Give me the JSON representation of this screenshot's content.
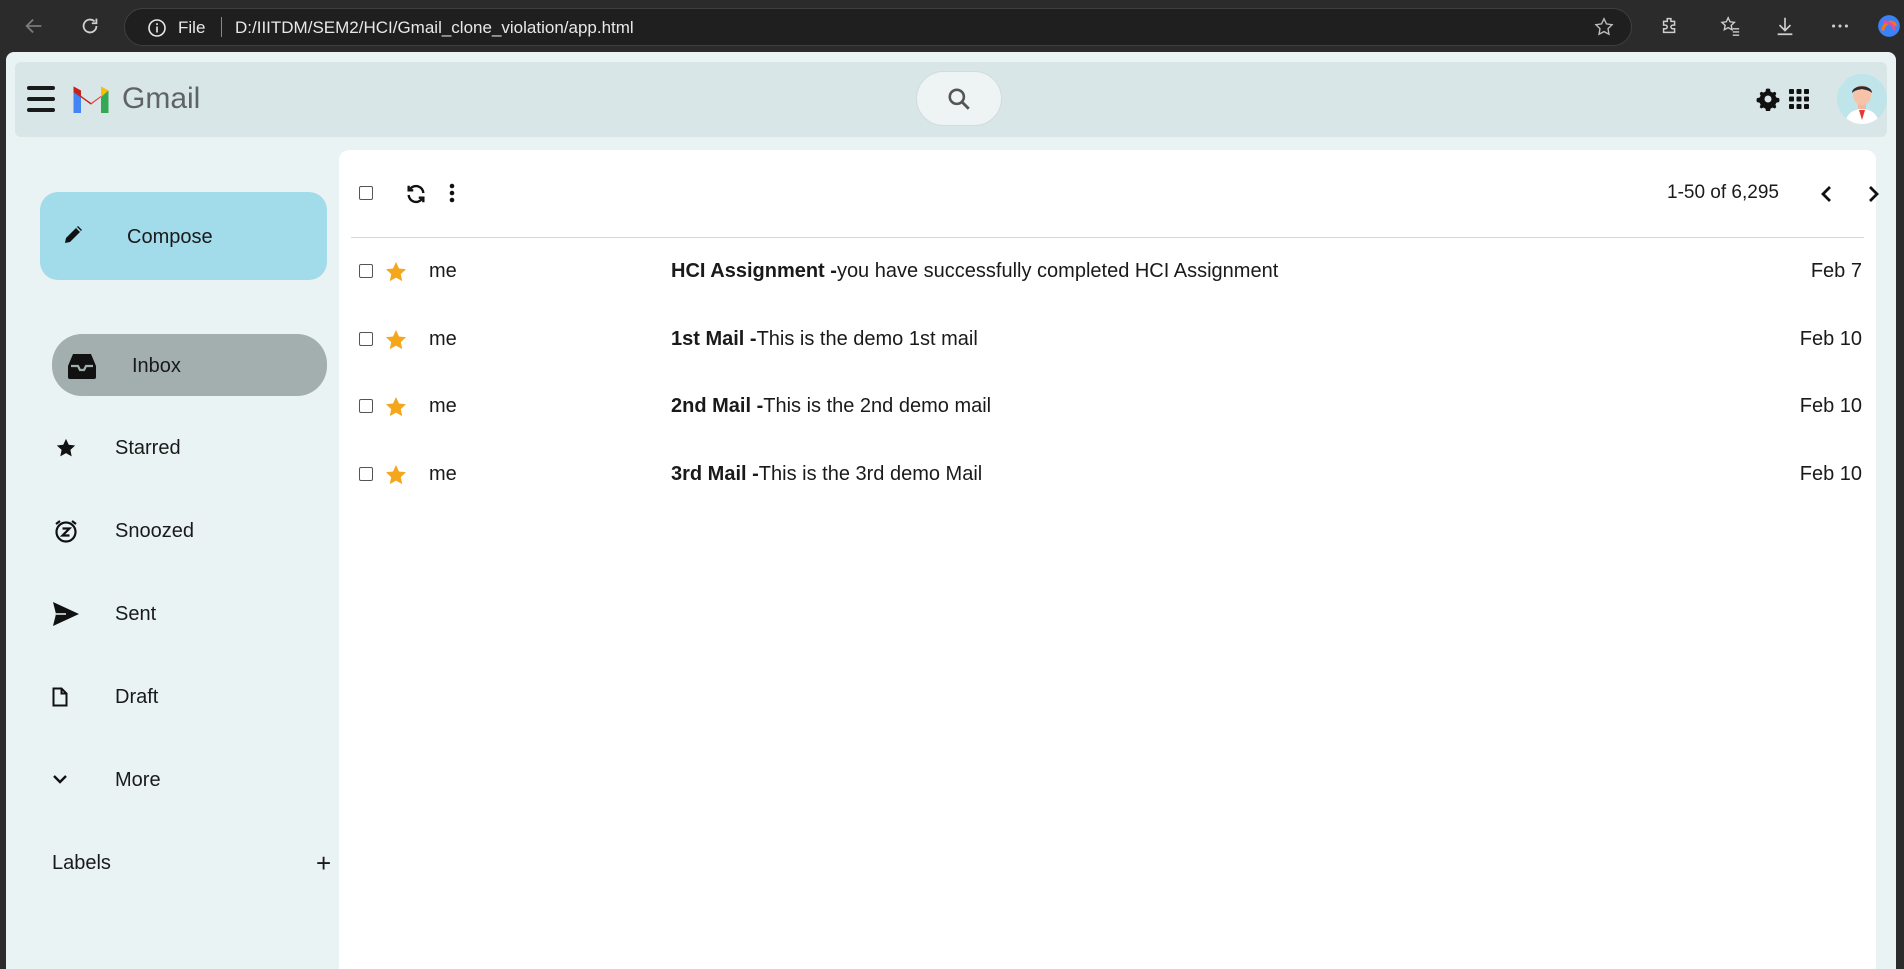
{
  "browser": {
    "address_prefix": "File",
    "url": "D:/IIITDM/SEM2/HCI/Gmail_clone_violation/app.html"
  },
  "header": {
    "brand": "Gmail",
    "icons": [
      "menu-icon",
      "gmail-logo",
      "search-icon",
      "gear-icon",
      "apps-icon",
      "avatar"
    ]
  },
  "sidebar": {
    "compose_label": "Compose",
    "items": [
      {
        "label": "Inbox",
        "icon": "inbox-icon",
        "active": true
      },
      {
        "label": "Starred",
        "icon": "star-icon"
      },
      {
        "label": "Snoozed",
        "icon": "snooze-icon"
      },
      {
        "label": "Sent",
        "icon": "send-icon"
      },
      {
        "label": "Draft",
        "icon": "file-icon"
      },
      {
        "label": "More",
        "icon": "chevron-down-icon"
      }
    ],
    "labels_heading": "Labels",
    "labels_add": "+"
  },
  "toolbar": {
    "pagination": "1-50 of 6,295"
  },
  "emails": [
    {
      "sender": "me",
      "subject": "HCI Assignment -",
      "snippet": "you have successfully completed HCI Assignment",
      "date": "Feb 7",
      "starred": true
    },
    {
      "sender": "me",
      "subject": "1st Mail -",
      "snippet": "This is the demo 1st mail",
      "date": "Feb 10",
      "starred": true
    },
    {
      "sender": "me",
      "subject": "2nd Mail -",
      "snippet": "This is the 2nd demo mail",
      "date": "Feb 10",
      "starred": true
    },
    {
      "sender": "me",
      "subject": "3rd Mail -",
      "snippet": "This is the 3rd demo Mail",
      "date": "Feb 10",
      "starred": true
    }
  ],
  "colors": {
    "compose_bg": "#a2dceb",
    "active_item_bg": "#a3aeae",
    "star": "#f4a61c",
    "page_bg": "#e9f3f4"
  }
}
